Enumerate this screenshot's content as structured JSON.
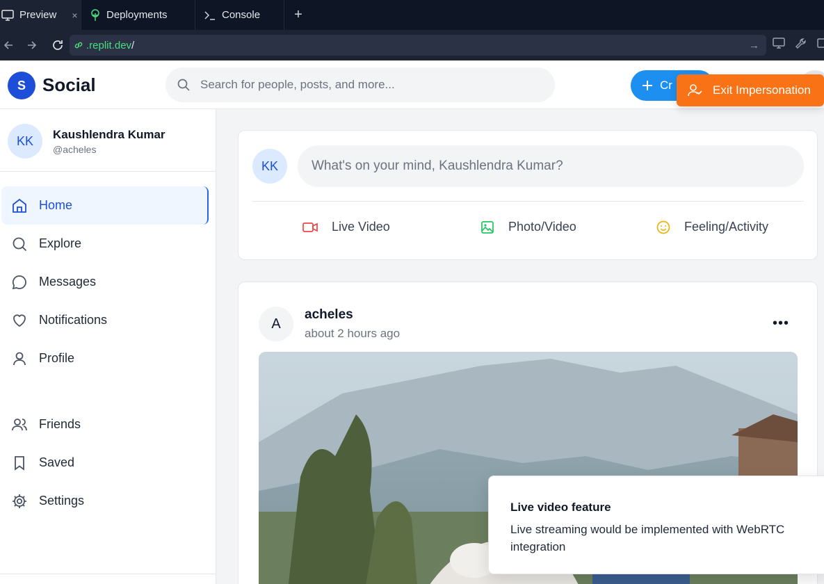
{
  "browser": {
    "tabs": [
      {
        "label": "Preview",
        "icon": "monitor-icon",
        "active": true
      },
      {
        "label": "Deployments",
        "icon": "tree-icon",
        "active": false
      },
      {
        "label": "Console",
        "icon": "terminal-icon",
        "active": false
      }
    ],
    "close_glyph": "×",
    "new_tab_glyph": "+",
    "url_domain": ".replit.dev",
    "url_path": "/",
    "go_glyph": "→"
  },
  "header": {
    "logo_letter": "S",
    "logo_text": "Social",
    "search_placeholder": "Search for people, posts, and more...",
    "create_label": "Cr",
    "exit_impersonation_label": "Exit Impersonation",
    "accent_color": "#1d8ff0",
    "exit_color": "#f97316"
  },
  "user": {
    "initials": "KK",
    "name": "Kaushlendra Kumar",
    "handle": "@acheles"
  },
  "sidebar": {
    "items": [
      {
        "label": "Home",
        "icon": "home-icon",
        "active": true
      },
      {
        "label": "Explore",
        "icon": "search-icon",
        "active": false
      },
      {
        "label": "Messages",
        "icon": "message-icon",
        "active": false
      },
      {
        "label": "Notifications",
        "icon": "heart-icon",
        "active": false
      },
      {
        "label": "Profile",
        "icon": "user-icon",
        "active": false
      },
      {
        "label": "Friends",
        "icon": "users-icon",
        "active": false
      },
      {
        "label": "Saved",
        "icon": "bookmark-icon",
        "active": false
      },
      {
        "label": "Settings",
        "icon": "gear-icon",
        "active": false
      }
    ]
  },
  "composer": {
    "initials": "KK",
    "placeholder": "What's on your mind, Kaushlendra Kumar?",
    "actions": [
      {
        "label": "Live Video",
        "icon": "video-icon",
        "color": "#ef4444"
      },
      {
        "label": "Photo/Video",
        "icon": "image-icon",
        "color": "#22c55e"
      },
      {
        "label": "Feeling/Activity",
        "icon": "smile-icon",
        "color": "#eab308"
      }
    ]
  },
  "post": {
    "avatar_letter": "A",
    "author": "acheles",
    "time": "about 2 hours ago",
    "more_glyph": "•••"
  },
  "toast": {
    "title": "Live video feature",
    "body": "Live streaming would be implemented with WebRTC integration"
  }
}
